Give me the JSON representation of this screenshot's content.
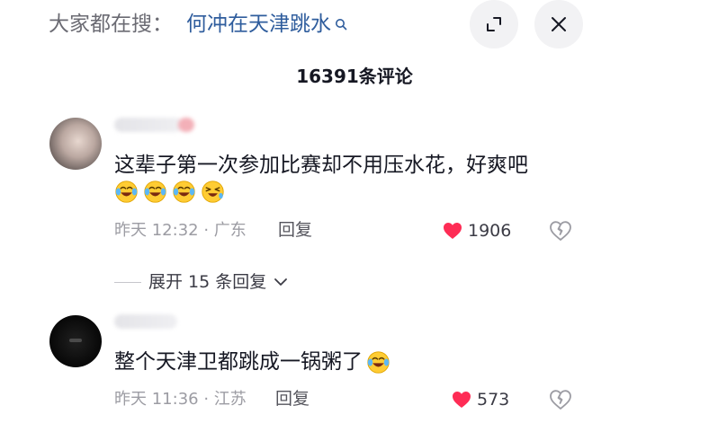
{
  "suggestion": {
    "prefix": "大家都在搜：",
    "query": "何冲在天津跳水"
  },
  "comment_count": "16391条评论",
  "comments": [
    {
      "text": "这辈子第一次参加比赛却不用压水花，好爽吧",
      "emojis": [
        "laugh-cry-emoji",
        "laugh-cry-emoji",
        "laugh-cry-emoji",
        "wink-laugh-emoji"
      ],
      "meta": "昨天 12:32 · 广东",
      "reply_label": "回复",
      "likes": "1906",
      "liked": true,
      "expand_label": "展开 15 条回复"
    },
    {
      "text": "整个天津卫都跳成一锅粥了",
      "emojis": [
        "laugh-cry-emoji"
      ],
      "meta": "昨天 11:36 · 江苏",
      "reply_label": "回复",
      "likes": "573",
      "liked": true
    }
  ],
  "colors": {
    "accent_blue": "#2f5d9d",
    "like_red": "#fe2c55",
    "meta_gray": "#9c9ca3"
  }
}
